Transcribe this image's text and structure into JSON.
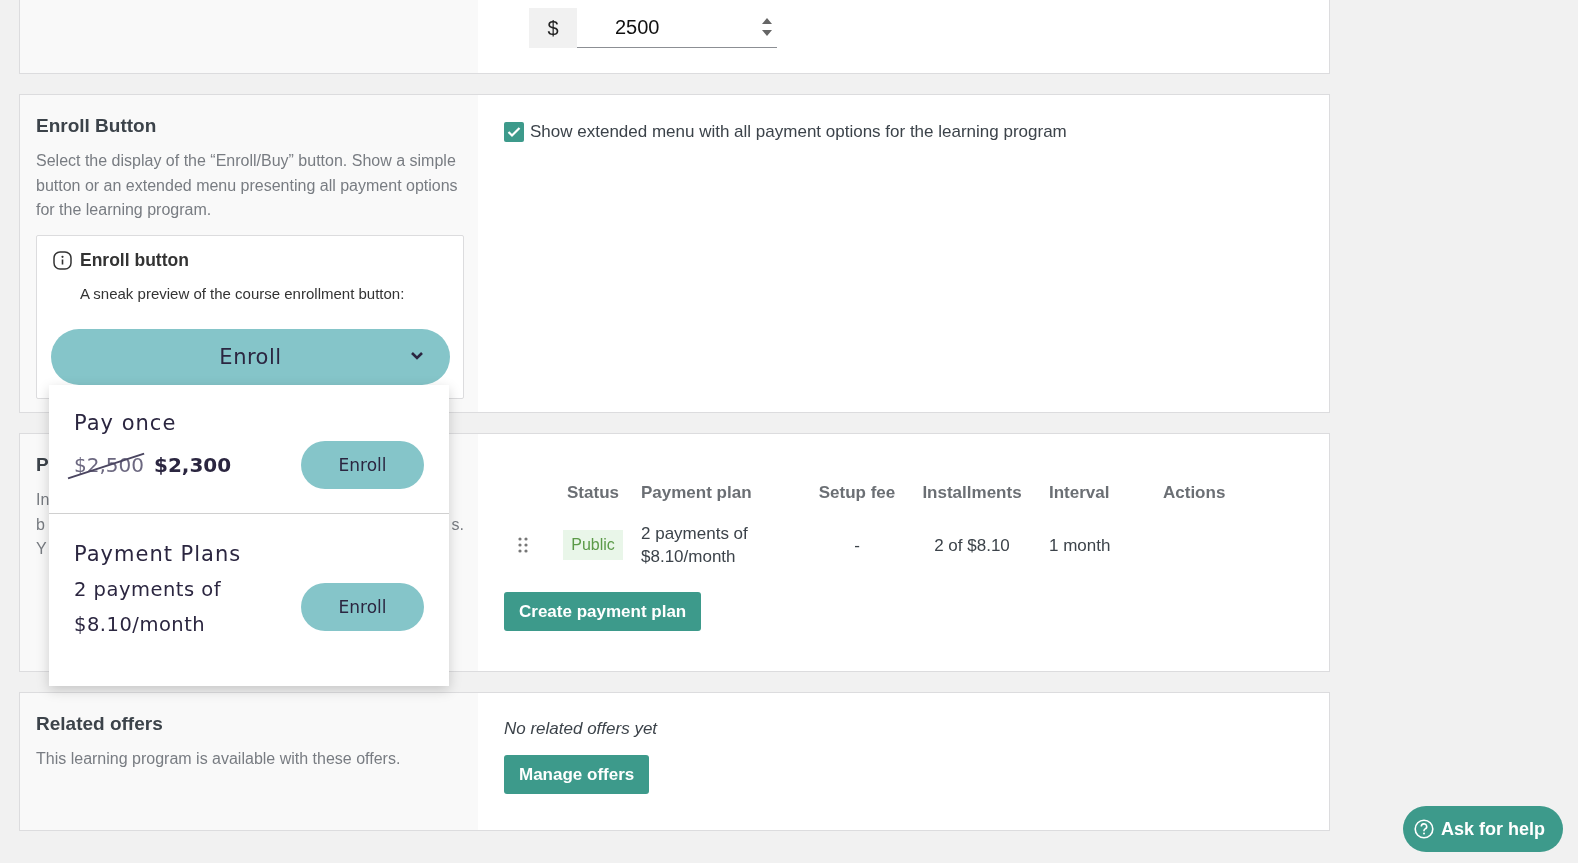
{
  "price_field": {
    "currency": "$",
    "value": "2500"
  },
  "enroll_button_section": {
    "title": "Enroll Button",
    "description": "Select the display of the “Enroll/Buy” button. Show a simple button or an extended menu presenting all payment options for the learning program.",
    "preview": {
      "title": "Enroll button",
      "subtitle": "A sneak preview of the course enrollment button:",
      "button_label": "Enroll",
      "expanded": true,
      "menu": [
        {
          "kind": "one-time",
          "title": "Pay once",
          "old_price": "$2,500",
          "price": "$2,300",
          "button": "Enroll"
        },
        {
          "kind": "plan",
          "title": "Payment Plans",
          "price": "2 payments of $8.10/month",
          "button": "Enroll"
        }
      ]
    },
    "extended_menu_option": {
      "label": "Show extended menu with all payment options for the learning program",
      "checked": true
    }
  },
  "payment_plans_section": {
    "title": "P",
    "description_lines": [
      {
        "start": "In"
      },
      {
        "start": "b",
        "end": "s."
      },
      {
        "start": "Y"
      }
    ],
    "table": {
      "columns": [
        "Status",
        "Payment plan",
        "Setup fee",
        "Installments",
        "Interval",
        "Actions"
      ],
      "rows": [
        {
          "status": "Public",
          "payment_plan": "2 payments of $8.10/month",
          "setup_fee": "-",
          "installments": "2 of $8.10",
          "interval": "1 month"
        }
      ]
    },
    "create_button": "Create payment plan"
  },
  "related_offers_section": {
    "title": "Related offers",
    "description": "This learning program is available with these offers.",
    "empty_text": "No related offers yet",
    "manage_button": "Manage offers"
  },
  "help_button": "Ask for help"
}
